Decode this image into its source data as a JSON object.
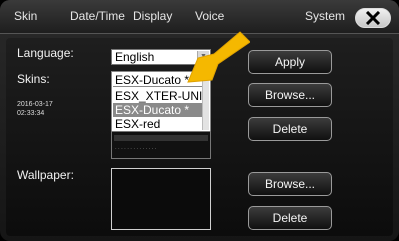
{
  "tabs": [
    "Skin",
    "Date/Time",
    "Display",
    "Voice",
    "System"
  ],
  "language": {
    "label": "Language:",
    "value": "English"
  },
  "skins": {
    "label": "Skins:",
    "selected": "ESX-Ducato *",
    "options": [
      "ESX_XTER-UNI",
      "ESX-Ducato *",
      "ESX-red"
    ]
  },
  "datetime": {
    "date": "2016-03-17",
    "time": "02:33:34"
  },
  "preview": {
    "text": "· · · · · · · · · · · · · ·"
  },
  "wallpaper": {
    "label": "Wallpaper:"
  },
  "buttons": {
    "apply": "Apply",
    "browse_skin": "Browse...",
    "delete_skin": "Delete",
    "browse_wallpaper": "Browse...",
    "delete_wallpaper": "Delete"
  },
  "icons": {
    "close": "close-icon",
    "pointer": "arrow-pointer-icon",
    "dropdown": "chevron-down-icon"
  },
  "colors": {
    "pointer": "#f5b800",
    "background": "#111111",
    "selection": "#8a8a8a"
  }
}
